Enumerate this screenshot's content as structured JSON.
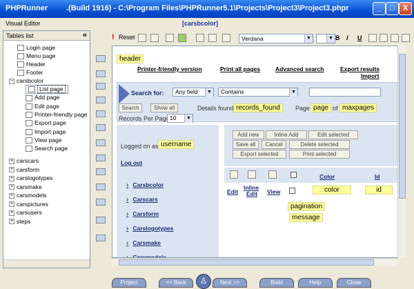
{
  "window": {
    "app_name": "PHPRunner",
    "build_path": ".(Build 1916) - C:\\Program Files\\PHPRunner5.1\\Projects\\Project3\\Project3.phpr",
    "min": "_",
    "max": "□",
    "close": "X"
  },
  "menu": {
    "visual_editor": "Visual Editor",
    "table_title": "[carsbcolor]"
  },
  "left_panel": {
    "header": "Tables list",
    "collapse": "«",
    "items": [
      "Login page",
      "Menu page",
      "Header",
      "Footer",
      "carsbcolor",
      "List page",
      "Add page",
      "Edit page",
      "Printer-friendly page",
      "Export page",
      "Import page",
      "View page",
      "Search page",
      "carscars",
      "carsform",
      "carslogotypes",
      "carsmake",
      "carsmodels",
      "carspictures",
      "carsusers",
      "steps"
    ]
  },
  "toolbar": {
    "reset": "Reset",
    "font": "Verdana",
    "bold": "B",
    "italic": "I",
    "underline": "U"
  },
  "canvas": {
    "header_tag": "header",
    "links": [
      "Printer-friendly version",
      "Print all pages",
      "Advanced search",
      "Export results"
    ],
    "import": "Import",
    "search_for": "Search for:",
    "any_field": "Any field",
    "contains": "Contains",
    "search_btn": "Search",
    "show_all_btn": "Show all",
    "details_found": "Details found:",
    "records_found": "records_found",
    "page_label": "Page",
    "page_tag": "page",
    "of_label": "of",
    "maxpages": "maxpages",
    "records_per_page": "Records Per Page:",
    "rpp_value": "10",
    "logged_on_as": "Logged on as",
    "username": "username",
    "log_out": "Log out",
    "actions": [
      "Add new",
      "Inline Add",
      "Edit selected",
      "Save all",
      "Cancel",
      "Delete selected",
      "Export selected",
      "Print selected"
    ],
    "col_color": "Color",
    "col_id": "Id",
    "row_edit": "Edit",
    "row_inline_edit_1": "Inline",
    "row_inline_edit_2": "Edit",
    "row_view": "View",
    "color_tag": "color",
    "id_tag": "id",
    "pagination": "pagination",
    "message": "message",
    "nav": [
      "Carsbcolor",
      "Carscars",
      "Carsform",
      "Carslogotypes",
      "Carsmake",
      "Carsmodels"
    ]
  },
  "bottom": {
    "buttons": [
      "Project",
      "<< Back",
      "Next >>",
      "Build",
      "Help",
      "Close"
    ]
  }
}
